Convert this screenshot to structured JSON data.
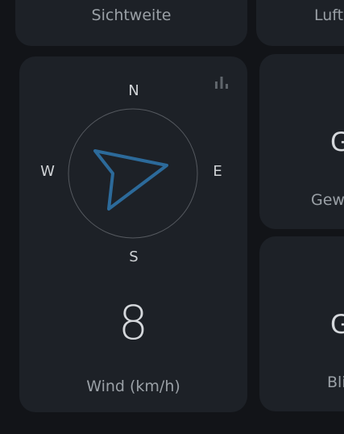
{
  "top_left_card": {
    "label": "Sichtweite"
  },
  "top_right_card": {
    "label_partial": "Luft"
  },
  "wind_card": {
    "compass": {
      "north": "N",
      "east": "E",
      "south": "S",
      "west": "W"
    },
    "value": "8",
    "label": "Wind (km/h)",
    "icon": "bar-chart-icon",
    "arrow_color": "#2c6a9a"
  },
  "right_mid_card": {
    "value_partial": "G",
    "label_partial": "Gew"
  },
  "right_bottom_card": {
    "value_partial": "G",
    "label_partial": "Bli"
  },
  "colors": {
    "background": "#121418",
    "card": "#1d2127",
    "text": "#d5d8dc",
    "muted_text": "#9aa0a6"
  }
}
